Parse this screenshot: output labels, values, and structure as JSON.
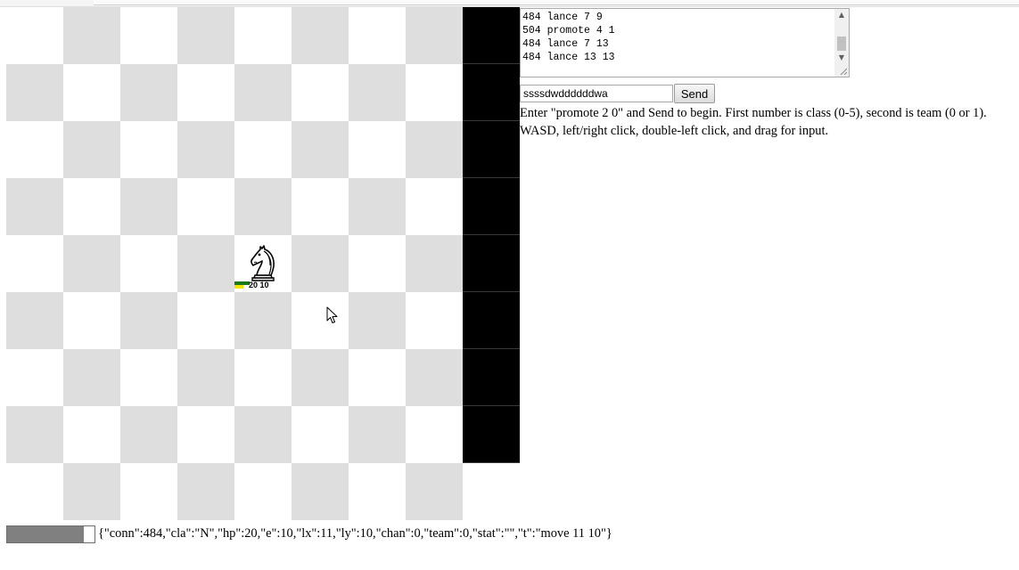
{
  "log": {
    "lines": [
      "484 lance 7 9",
      "504 promote 4 1",
      "484 lance 7 13",
      "484 lance 13 13"
    ]
  },
  "command": {
    "value": "ssssdwddddddwa",
    "send_label": "Send"
  },
  "help": {
    "line1": "Enter \"promote 2 0\" and Send to begin. First number is class (0-5), second is team (0 or 1).",
    "line2": "WASD, left/right click, double-left click, and drag for input."
  },
  "board": {
    "size": 9,
    "wall_column": 8,
    "wall_rows": 8,
    "light_color": "#ffffff",
    "dark_color": "#dedede",
    "wall_color": "#000000"
  },
  "piece": {
    "icon": "knight-icon",
    "hp": "20",
    "energy": "10",
    "hp_color": "#1a7a1a",
    "energy_color": "#f2e600"
  },
  "status": {
    "progress_fraction": 0.88,
    "json_text": "{\"conn\":484,\"cla\":\"N\",\"hp\":20,\"e\":10,\"lx\":11,\"ly\":10,\"chan\":0,\"team\":0,\"stat\":\"\",\"t\":\"move 11 10\"}"
  }
}
